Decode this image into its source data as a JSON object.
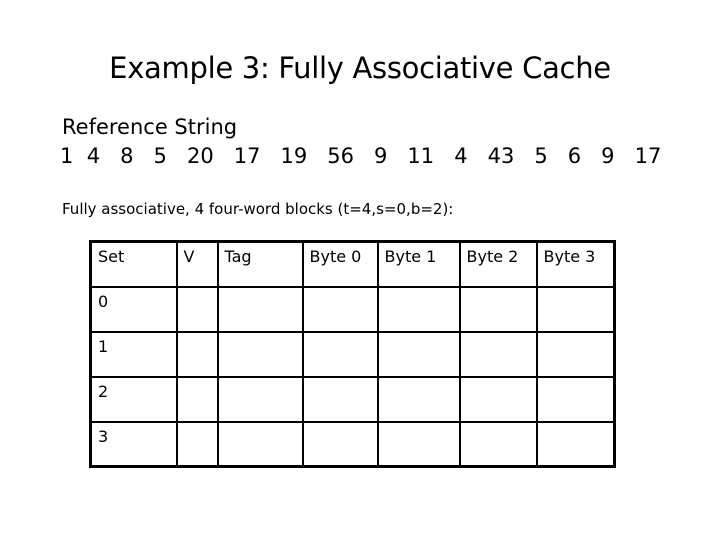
{
  "title": "Example 3: Fully Associative Cache",
  "reference": {
    "label": "Reference String",
    "values": [
      "1",
      "4",
      "8",
      "5",
      "20",
      "17",
      "19",
      "56",
      "9",
      "11",
      "4",
      "43",
      "5",
      "6",
      "9",
      "17"
    ]
  },
  "description": "Fully associative, 4 four-word blocks (t=4,s=0,b=2):",
  "table": {
    "headers": [
      "Set",
      "V",
      "Tag",
      "Byte 0",
      "Byte 1",
      "Byte 2",
      "Byte 3"
    ],
    "rows": [
      [
        "0",
        "",
        "",
        "",
        "",
        "",
        ""
      ],
      [
        "1",
        "",
        "",
        "",
        "",
        "",
        ""
      ],
      [
        "2",
        "",
        "",
        "",
        "",
        "",
        ""
      ],
      [
        "3",
        "",
        "",
        "",
        "",
        "",
        ""
      ]
    ]
  }
}
